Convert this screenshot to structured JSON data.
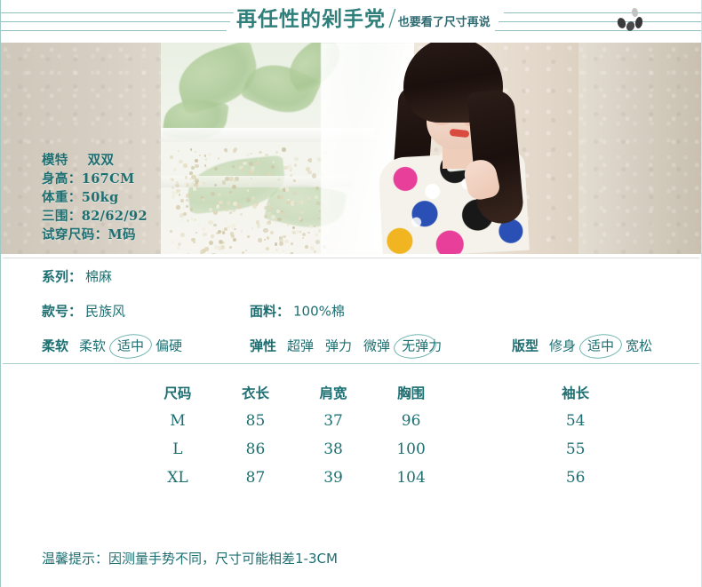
{
  "header": {
    "title_main": "再任性的剁手党",
    "slash": "/",
    "title_sub": "也要看了尺寸再说"
  },
  "model_info": {
    "name_label": "模特",
    "name": "双双",
    "height": "身高：167CM",
    "weight": "体重：50kg",
    "measurements": "三围：82/62/92",
    "try_size": "试穿尺码：M码"
  },
  "spec": {
    "series_label": "系列：",
    "series_value": "棉麻",
    "style_label": "款号：",
    "style_value": "民族风",
    "fabric_label": "面料：",
    "fabric_value": "100%棉",
    "softness": {
      "label": "柔软",
      "options": [
        "柔软",
        "适中",
        "偏硬"
      ],
      "selected": "适中"
    },
    "elasticity": {
      "label": "弹性",
      "options": [
        "超弹",
        "弹力",
        "微弹",
        "无弹力"
      ],
      "selected": "无弹力"
    },
    "fit": {
      "label": "版型",
      "options": [
        "修身",
        "适中",
        "宽松"
      ],
      "selected": "适中"
    }
  },
  "size_table": {
    "headers": [
      "尺码",
      "衣长",
      "肩宽",
      "胸围",
      "袖长"
    ],
    "rows": [
      [
        "M",
        "85",
        "37",
        "96",
        "54"
      ],
      [
        "L",
        "86",
        "38",
        "100",
        "55"
      ],
      [
        "XL",
        "87",
        "39",
        "104",
        "56"
      ]
    ]
  },
  "footer": {
    "note": "温馨提示：因测量手势不同，尺寸可能相差1-3CM"
  },
  "colors": {
    "text_teal": "#1d6f72",
    "title_teal": "#2f7f7b",
    "line_teal": "#8fc2bf",
    "circle_teal": "#6fb5b0",
    "wall_beige": "#d6cec2"
  }
}
